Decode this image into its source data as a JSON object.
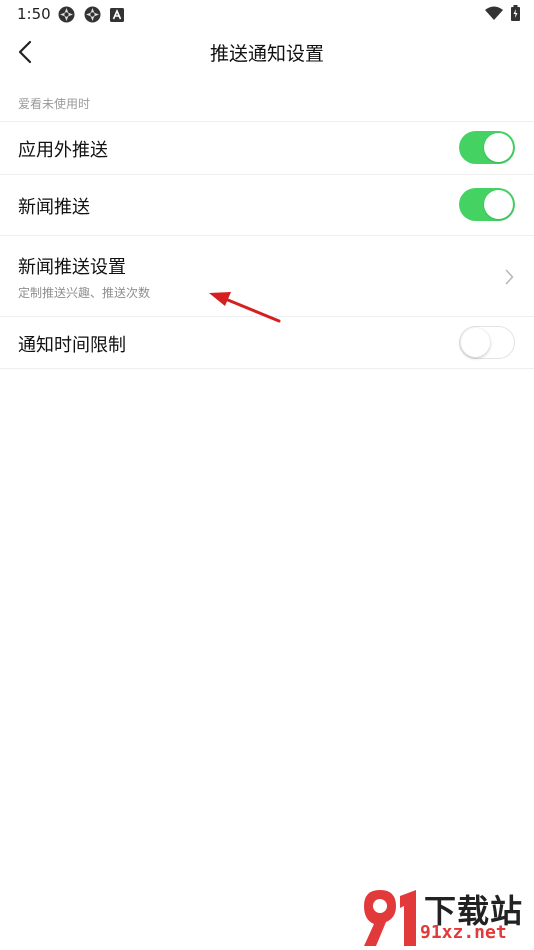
{
  "status_bar": {
    "time": "1:50"
  },
  "header": {
    "title": "推送通知设置"
  },
  "section": {
    "label": "爱看未使用时"
  },
  "settings": [
    {
      "label": "应用外推送",
      "toggle": true
    },
    {
      "label": "新闻推送",
      "toggle": true
    },
    {
      "label": "新闻推送设置",
      "sub": "定制推送兴趣、推送次数"
    },
    {
      "label": "通知时间限制",
      "toggle": false
    }
  ],
  "watermark": {
    "brand": "下载站",
    "domain": "91xz.net",
    "logo_text": "91"
  },
  "colors": {
    "toggle_on": "#44d363",
    "annotation_arrow": "#d42020",
    "watermark_red": "#e23a3a"
  },
  "icons": {
    "back": "chevron-left-icon",
    "chevron": "chevron-right-icon"
  }
}
